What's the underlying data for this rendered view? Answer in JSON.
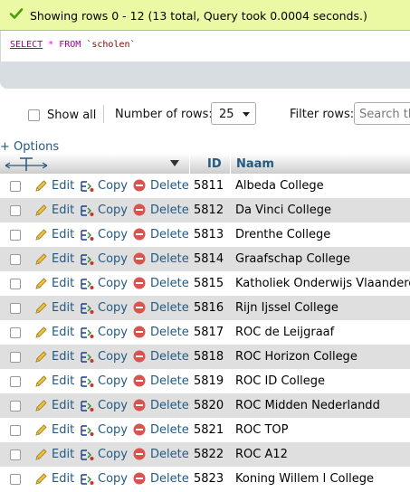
{
  "message": {
    "text": "Showing rows 0 - 12 (13 total, Query took 0.0004 seconds.)"
  },
  "sql": {
    "select": "SELECT",
    "star": "*",
    "from": "FROM",
    "table": "`scholen`"
  },
  "nav": {
    "show_all": "Show all",
    "number_of_rows_label": "Number of rows:",
    "number_of_rows_value": "25",
    "filter_label": "Filter rows:",
    "search_placeholder": "Search this table"
  },
  "options_link": "+ Options",
  "columns": {
    "id": "ID",
    "naam": "Naam"
  },
  "actions": {
    "edit": "Edit",
    "copy": "Copy",
    "delete": "Delete"
  },
  "rows": [
    {
      "id": "5811",
      "naam": "Albeda College"
    },
    {
      "id": "5812",
      "naam": "Da Vinci College"
    },
    {
      "id": "5813",
      "naam": "Drenthe College"
    },
    {
      "id": "5814",
      "naam": "Graafschap College"
    },
    {
      "id": "5815",
      "naam": "Katholiek Onderwijs Vlaanderen"
    },
    {
      "id": "5816",
      "naam": "Rijn Ijssel College"
    },
    {
      "id": "5817",
      "naam": "ROC de Leijgraaf"
    },
    {
      "id": "5818",
      "naam": "ROC Horizon College"
    },
    {
      "id": "5819",
      "naam": "ROC ID College"
    },
    {
      "id": "5820",
      "naam": "ROC Midden Nederlandd"
    },
    {
      "id": "5821",
      "naam": "ROC TOP"
    },
    {
      "id": "5822",
      "naam": "ROC A12"
    },
    {
      "id": "5823",
      "naam": "Koning Willem I College"
    }
  ],
  "colors": {
    "link": "#235a81",
    "success_bg": "#ebf8a4",
    "row_alt": "#dfdfdf",
    "delete_red": "#d9534f"
  }
}
